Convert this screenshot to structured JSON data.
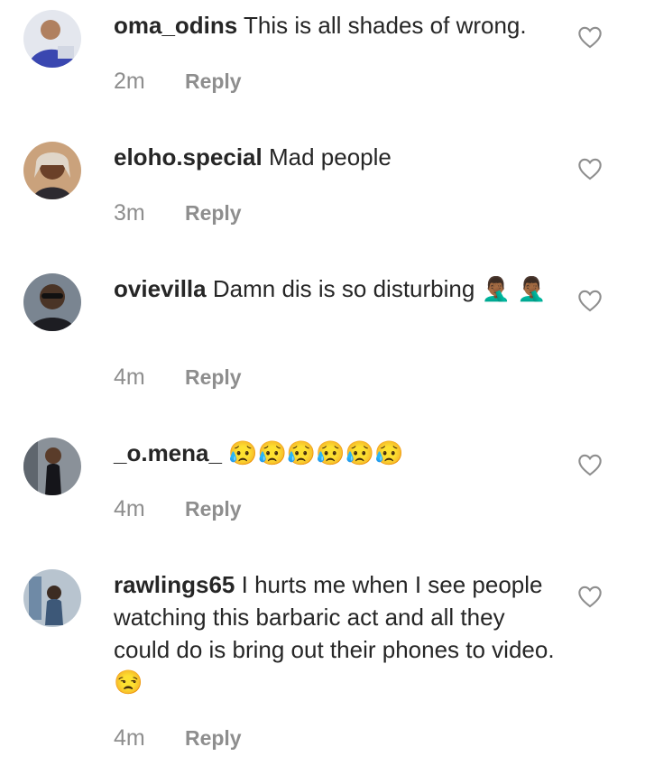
{
  "comments": [
    {
      "username": "oma_odins",
      "text": "This is all shades of wrong.",
      "emoji": "",
      "time": "2m",
      "reply": "Reply",
      "avatar_icon": "avatar-oma-odins",
      "avatar_bg": "#dfe3ea"
    },
    {
      "username": "eloho.special",
      "text": "Mad people",
      "emoji": "",
      "time": "3m",
      "reply": "Reply",
      "avatar_icon": "avatar-eloho-special",
      "avatar_bg": "#c9a07a"
    },
    {
      "username": "ovievilla",
      "text": "Damn dis is so disturbing",
      "emoji": "🤦🏾‍♂️ 🤦🏾‍♂️",
      "time": "4m",
      "reply": "Reply",
      "avatar_icon": "avatar-ovievilla",
      "avatar_bg": "#6a7480"
    },
    {
      "username": "_o.mena_",
      "text": "",
      "emoji": "😥😥😥😥😥😥",
      "time": "4m",
      "reply": "Reply",
      "avatar_icon": "avatar-o-mena",
      "avatar_bg": "#7d858f"
    },
    {
      "username": "rawlings65",
      "text": "I hurts me when I see people watching this barbaric act and all they could do is bring out their phones to video.",
      "emoji": "😒",
      "time": "4m",
      "reply": "Reply",
      "avatar_icon": "avatar-rawlings65",
      "avatar_bg": "#a9b7c4"
    }
  ],
  "colors": {
    "text": "#262626",
    "meta": "#8e8e8e",
    "heart": "#8e8e8e"
  },
  "icons": {
    "like": "heart-outline-icon"
  }
}
